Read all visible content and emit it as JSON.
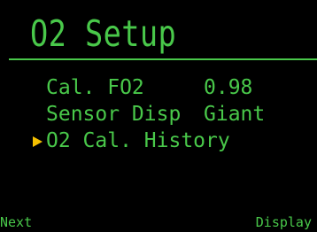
{
  "screen": {
    "title": "O2 Setup",
    "colors": {
      "background": "#000000",
      "text": "#49c84a",
      "cursor": "#f5c000"
    }
  },
  "menu": {
    "items": [
      {
        "label": "Cal. FO2",
        "value": "0.98",
        "selected": false
      },
      {
        "label": "Sensor Disp",
        "value": "Giant",
        "selected": false
      },
      {
        "label": "O2 Cal. History",
        "value": "",
        "selected": true
      }
    ],
    "cursor_icon": "triangle-right-icon"
  },
  "softkeys": {
    "left_label": "Next",
    "right_label": "Display"
  }
}
